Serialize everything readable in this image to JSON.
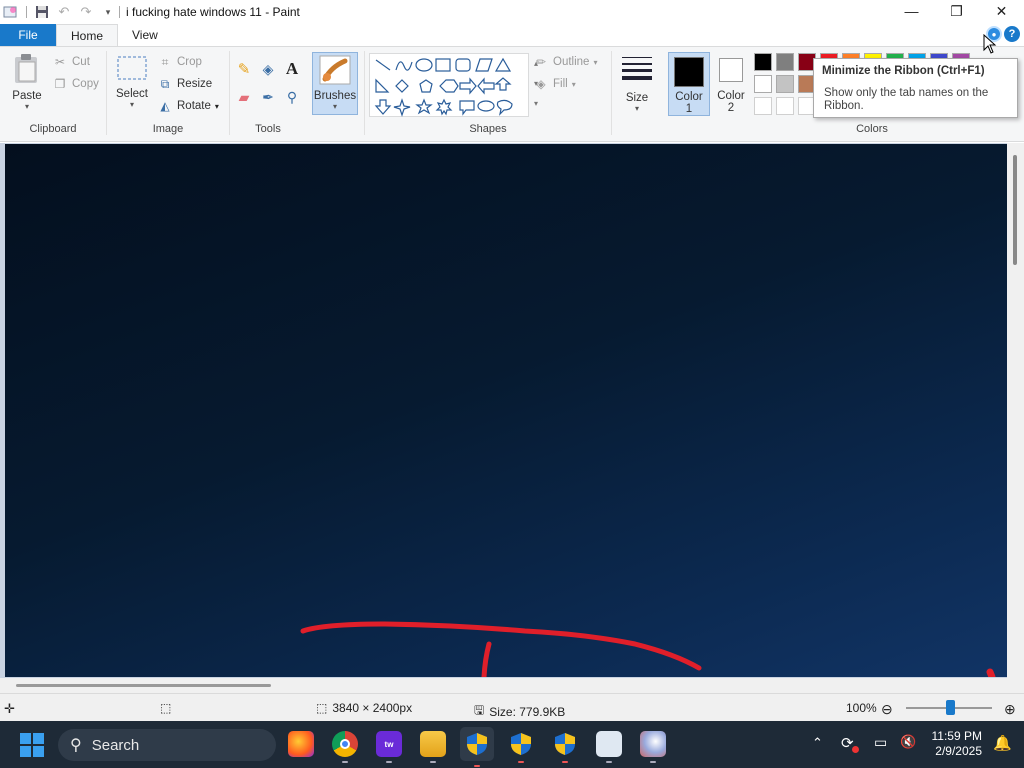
{
  "window": {
    "title": "i fucking hate windows 11 - Paint"
  },
  "tabs": {
    "file": "File",
    "home": "Home",
    "view": "View"
  },
  "ribbon": {
    "clipboard": {
      "group_label": "Clipboard",
      "paste": "Paste",
      "cut": "Cut",
      "copy": "Copy"
    },
    "image": {
      "group_label": "Image",
      "select": "Select",
      "crop": "Crop",
      "resize": "Resize",
      "rotate": "Rotate"
    },
    "tools": {
      "group_label": "Tools"
    },
    "brushes": {
      "label": "Brushes"
    },
    "shapes": {
      "group_label": "Shapes",
      "outline": "Outline",
      "fill": "Fill"
    },
    "size": {
      "label": "Size"
    },
    "color1": {
      "label": "Color",
      "num": "1",
      "value": "#000000"
    },
    "color2": {
      "label": "Color",
      "num": "2",
      "value": "#ffffff"
    },
    "colors": {
      "group_label": "Colors",
      "row1": [
        "#000000",
        "#7f7f7f",
        "#880015",
        "#ed1c24",
        "#ff7f27",
        "#fff200",
        "#22b14c",
        "#00a2e8",
        "#3f48cc",
        "#a349a4"
      ],
      "row2": [
        "#ffffff",
        "#c3c3c3",
        "#b97a57"
      ]
    }
  },
  "tooltip": {
    "title": "Minimize the Ribbon (Ctrl+F1)",
    "body": "Show only the tab names on the Ribbon."
  },
  "status": {
    "dimensions": "3840 × 2400px",
    "size": "Size: 779.9KB",
    "zoom": "100%"
  },
  "taskbar": {
    "search_label": "Search",
    "time": "11:59 PM",
    "date": "2/9/2025",
    "apps": [
      "firefox-icon",
      "chrome-icon",
      "twitch-icon",
      "file-explorer-icon",
      "shield-icon",
      "shield-icon",
      "shield-icon",
      "control-panel-icon",
      "paint-icon"
    ]
  },
  "icons": {
    "save": "save-icon",
    "undo": "undo-icon",
    "redo": "redo-icon",
    "minimize": "minimize-icon",
    "restore": "restore-icon",
    "close": "close-icon"
  }
}
